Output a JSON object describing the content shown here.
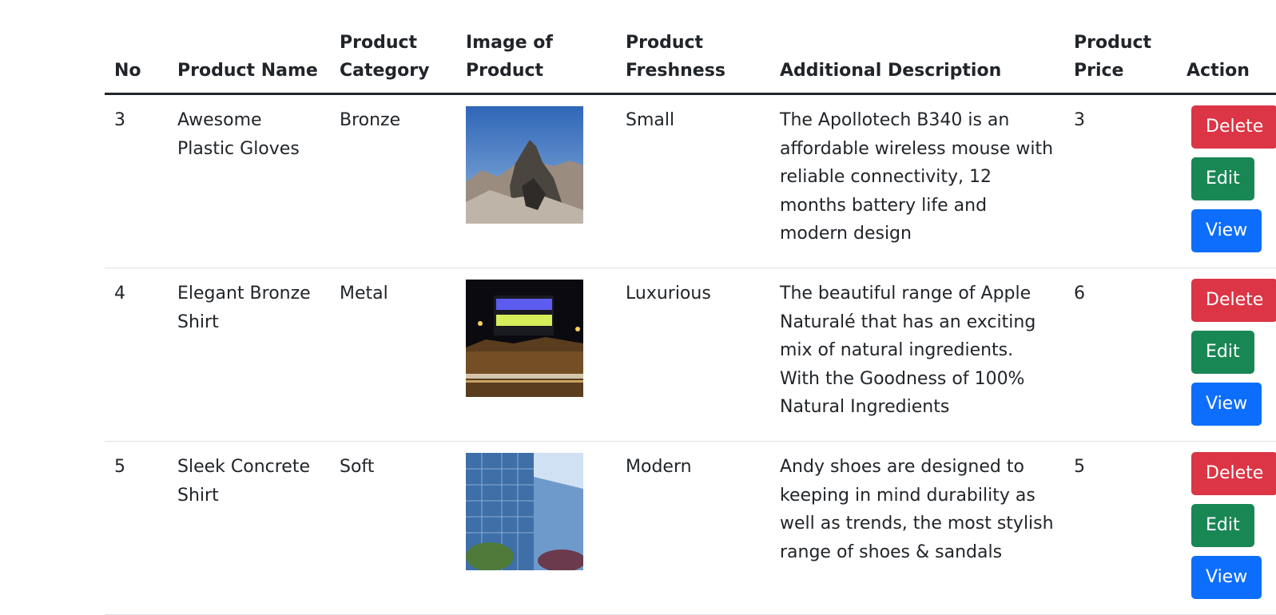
{
  "table": {
    "headers": {
      "no": "No",
      "name": "Product Name",
      "category": "Product Category",
      "image": "Image of Product",
      "freshness": "Product Freshness",
      "description": "Additional Description",
      "price": "Product Price",
      "action": "Action"
    },
    "rows": [
      {
        "no": "3",
        "name": "Awesome Plastic Gloves",
        "category": "Bronze",
        "image": "mountain-photo",
        "freshness": "Small",
        "description": "The Apollotech B340 is an affordable wireless mouse with reliable connectivity, 12 months battery life and modern design",
        "price": "3",
        "delete_label": "Delete",
        "edit_label": "Edit",
        "view_label": "View"
      },
      {
        "no": "4",
        "name": "Elegant Bronze Shirt",
        "category": "Metal",
        "image": "night-building-photo",
        "freshness": "Luxurious",
        "description": "The beautiful range of Apple Naturalé that has an exciting mix of natural ingredients. With the Goodness of 100% Natural Ingredients",
        "price": "6",
        "delete_label": "Delete",
        "edit_label": "Edit",
        "view_label": "View"
      },
      {
        "no": "5",
        "name": "Sleek Concrete Shirt",
        "category": "Soft",
        "image": "glass-building-photo",
        "freshness": "Modern",
        "description": "Andy shoes are designed to keeping in mind durability as well as trends, the most stylish range of shoes & sandals",
        "price": "5",
        "delete_label": "Delete",
        "edit_label": "Edit",
        "view_label": "View"
      }
    ]
  },
  "colors": {
    "delete": "#dc3545",
    "edit": "#198754",
    "view": "#0d6efd"
  }
}
